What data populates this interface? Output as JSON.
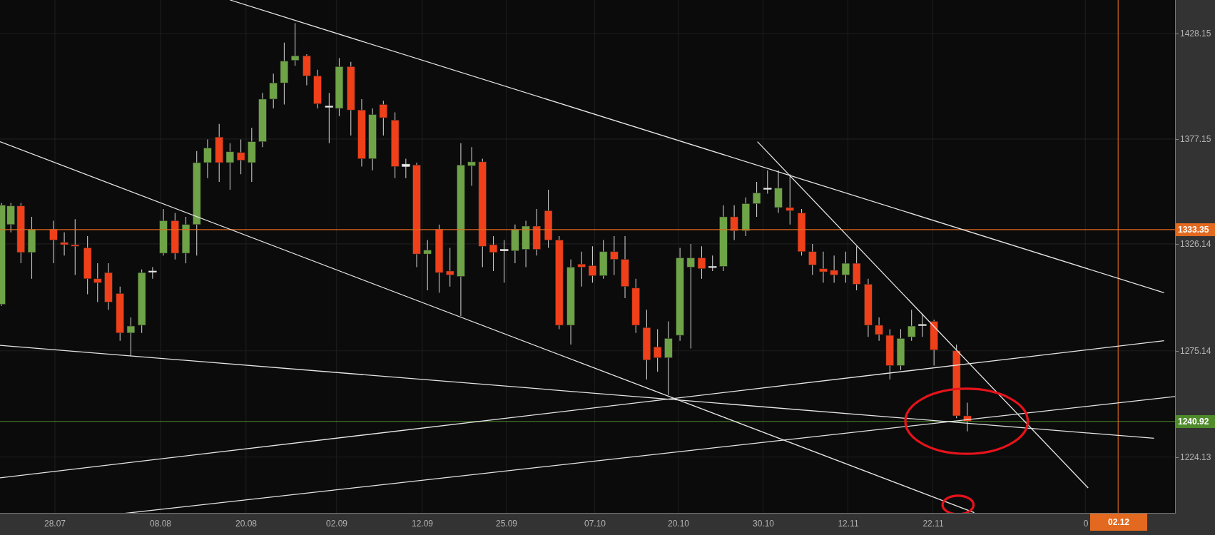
{
  "chart": {
    "price_labels": [
      "1428.15",
      "1377.15",
      "1326.14",
      "1275.14",
      "1224.13"
    ],
    "date_labels": [
      "28.07",
      "08.08",
      "20.08",
      "02.09",
      "12.09",
      "25.09",
      "07.10",
      "20.10",
      "30.10",
      "12.11",
      "22.11",
      "0"
    ],
    "price_markers": [
      {
        "label": "1333.35",
        "color": "#e2691f"
      },
      {
        "label": "1240.92",
        "color": "#4f8b2b"
      }
    ],
    "time_marker": {
      "label": "02.12",
      "color": "#e2691f"
    }
  }
}
